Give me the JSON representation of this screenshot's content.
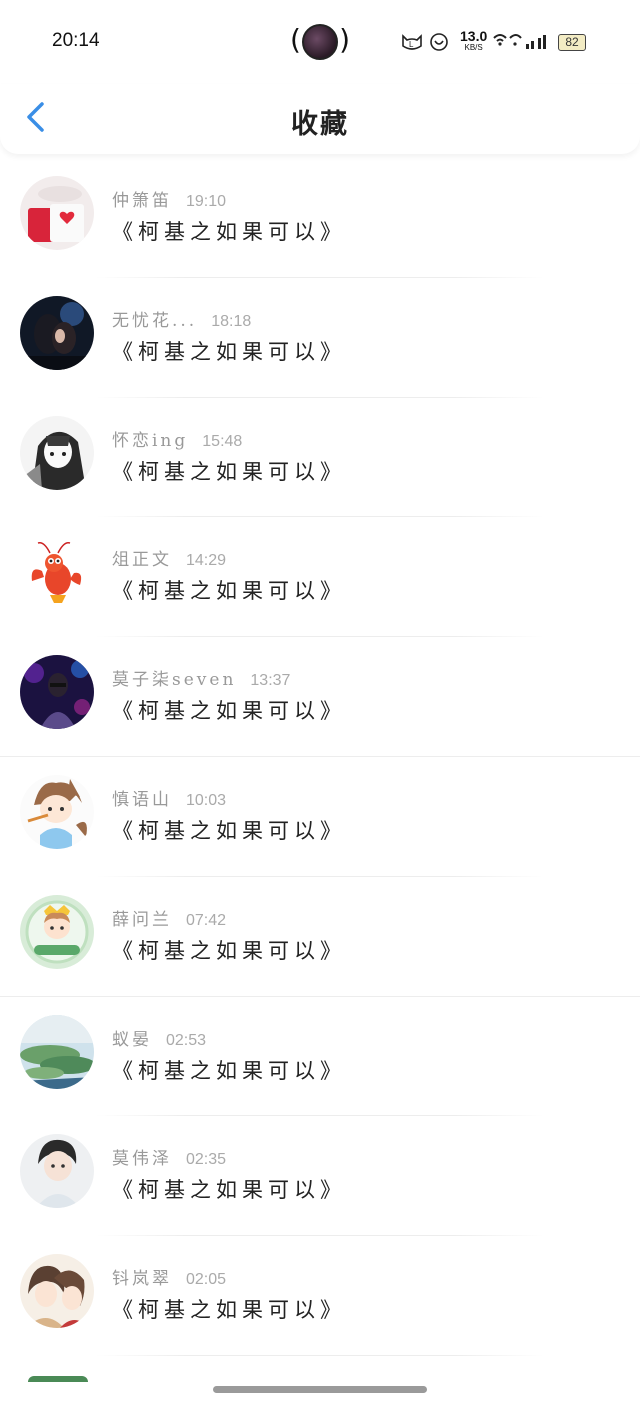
{
  "status_bar": {
    "time": "20:14",
    "net_speed_value": "13.0",
    "net_speed_unit": "KB/S",
    "battery_level": "82",
    "icons": [
      "live-activity-icon",
      "cat-face-icon",
      "smile-icon",
      "hd-signal-icon",
      "wifi-icon",
      "signal-icon",
      "battery-icon"
    ]
  },
  "header": {
    "title": "收藏",
    "back_icon": "chevron-left-icon",
    "accent": "#3a8ee6"
  },
  "favorites": [
    {
      "name": "仲箫笛",
      "time": "19:10",
      "song": "《柯基之如果可以》",
      "avatar": "red-heart-mug"
    },
    {
      "name": "无忧花...",
      "time": "18:18",
      "song": "《柯基之如果可以》",
      "avatar": "dark-couple"
    },
    {
      "name": "怀恋ing",
      "time": "15:48",
      "song": "《柯基之如果可以》",
      "avatar": "manga-girl"
    },
    {
      "name": "俎正文",
      "time": "14:29",
      "song": "《柯基之如果可以》",
      "avatar": "cartoon-lobster"
    },
    {
      "name": "莫子柒seven",
      "time": "13:37",
      "song": "《柯基之如果可以》",
      "avatar": "neon-person"
    },
    {
      "name": "慎语山",
      "time": "10:03",
      "song": "《柯基之如果可以》",
      "avatar": "cartoon-cat-boy"
    },
    {
      "name": "薛问兰",
      "time": "07:42",
      "song": "《柯基之如果可以》",
      "avatar": "chibi-badge"
    },
    {
      "name": "蚁晏",
      "time": "02:53",
      "song": "《柯基之如果可以》",
      "avatar": "island-landscape"
    },
    {
      "name": "莫伟泽",
      "time": "02:35",
      "song": "《柯基之如果可以》",
      "avatar": "young-man"
    },
    {
      "name": "钭岚翠",
      "time": "02:05",
      "song": "《柯基之如果可以》",
      "avatar": "illustrated-couple"
    }
  ]
}
